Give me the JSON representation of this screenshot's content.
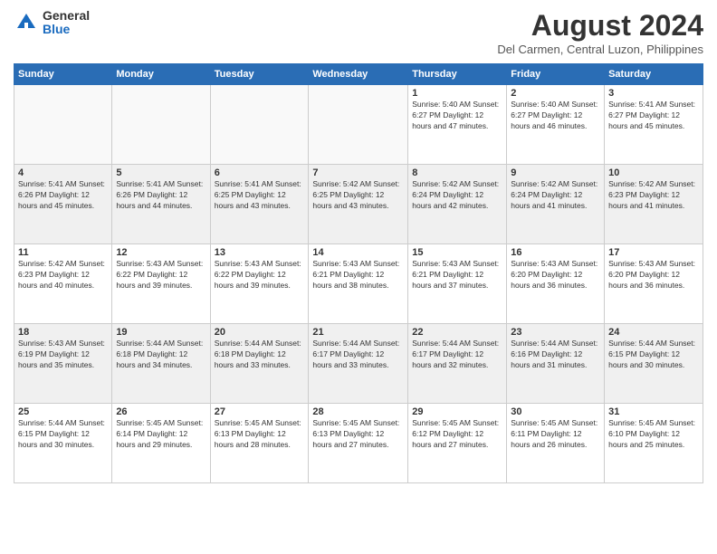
{
  "header": {
    "logo_general": "General",
    "logo_blue": "Blue",
    "month_year": "August 2024",
    "location": "Del Carmen, Central Luzon, Philippines"
  },
  "days_of_week": [
    "Sunday",
    "Monday",
    "Tuesday",
    "Wednesday",
    "Thursday",
    "Friday",
    "Saturday"
  ],
  "weeks": [
    [
      {
        "day": "",
        "info": ""
      },
      {
        "day": "",
        "info": ""
      },
      {
        "day": "",
        "info": ""
      },
      {
        "day": "",
        "info": ""
      },
      {
        "day": "1",
        "info": "Sunrise: 5:40 AM\nSunset: 6:27 PM\nDaylight: 12 hours\nand 47 minutes."
      },
      {
        "day": "2",
        "info": "Sunrise: 5:40 AM\nSunset: 6:27 PM\nDaylight: 12 hours\nand 46 minutes."
      },
      {
        "day": "3",
        "info": "Sunrise: 5:41 AM\nSunset: 6:27 PM\nDaylight: 12 hours\nand 45 minutes."
      }
    ],
    [
      {
        "day": "4",
        "info": "Sunrise: 5:41 AM\nSunset: 6:26 PM\nDaylight: 12 hours\nand 45 minutes."
      },
      {
        "day": "5",
        "info": "Sunrise: 5:41 AM\nSunset: 6:26 PM\nDaylight: 12 hours\nand 44 minutes."
      },
      {
        "day": "6",
        "info": "Sunrise: 5:41 AM\nSunset: 6:25 PM\nDaylight: 12 hours\nand 43 minutes."
      },
      {
        "day": "7",
        "info": "Sunrise: 5:42 AM\nSunset: 6:25 PM\nDaylight: 12 hours\nand 43 minutes."
      },
      {
        "day": "8",
        "info": "Sunrise: 5:42 AM\nSunset: 6:24 PM\nDaylight: 12 hours\nand 42 minutes."
      },
      {
        "day": "9",
        "info": "Sunrise: 5:42 AM\nSunset: 6:24 PM\nDaylight: 12 hours\nand 41 minutes."
      },
      {
        "day": "10",
        "info": "Sunrise: 5:42 AM\nSunset: 6:23 PM\nDaylight: 12 hours\nand 41 minutes."
      }
    ],
    [
      {
        "day": "11",
        "info": "Sunrise: 5:42 AM\nSunset: 6:23 PM\nDaylight: 12 hours\nand 40 minutes."
      },
      {
        "day": "12",
        "info": "Sunrise: 5:43 AM\nSunset: 6:22 PM\nDaylight: 12 hours\nand 39 minutes."
      },
      {
        "day": "13",
        "info": "Sunrise: 5:43 AM\nSunset: 6:22 PM\nDaylight: 12 hours\nand 39 minutes."
      },
      {
        "day": "14",
        "info": "Sunrise: 5:43 AM\nSunset: 6:21 PM\nDaylight: 12 hours\nand 38 minutes."
      },
      {
        "day": "15",
        "info": "Sunrise: 5:43 AM\nSunset: 6:21 PM\nDaylight: 12 hours\nand 37 minutes."
      },
      {
        "day": "16",
        "info": "Sunrise: 5:43 AM\nSunset: 6:20 PM\nDaylight: 12 hours\nand 36 minutes."
      },
      {
        "day": "17",
        "info": "Sunrise: 5:43 AM\nSunset: 6:20 PM\nDaylight: 12 hours\nand 36 minutes."
      }
    ],
    [
      {
        "day": "18",
        "info": "Sunrise: 5:43 AM\nSunset: 6:19 PM\nDaylight: 12 hours\nand 35 minutes."
      },
      {
        "day": "19",
        "info": "Sunrise: 5:44 AM\nSunset: 6:18 PM\nDaylight: 12 hours\nand 34 minutes."
      },
      {
        "day": "20",
        "info": "Sunrise: 5:44 AM\nSunset: 6:18 PM\nDaylight: 12 hours\nand 33 minutes."
      },
      {
        "day": "21",
        "info": "Sunrise: 5:44 AM\nSunset: 6:17 PM\nDaylight: 12 hours\nand 33 minutes."
      },
      {
        "day": "22",
        "info": "Sunrise: 5:44 AM\nSunset: 6:17 PM\nDaylight: 12 hours\nand 32 minutes."
      },
      {
        "day": "23",
        "info": "Sunrise: 5:44 AM\nSunset: 6:16 PM\nDaylight: 12 hours\nand 31 minutes."
      },
      {
        "day": "24",
        "info": "Sunrise: 5:44 AM\nSunset: 6:15 PM\nDaylight: 12 hours\nand 30 minutes."
      }
    ],
    [
      {
        "day": "25",
        "info": "Sunrise: 5:44 AM\nSunset: 6:15 PM\nDaylight: 12 hours\nand 30 minutes."
      },
      {
        "day": "26",
        "info": "Sunrise: 5:45 AM\nSunset: 6:14 PM\nDaylight: 12 hours\nand 29 minutes."
      },
      {
        "day": "27",
        "info": "Sunrise: 5:45 AM\nSunset: 6:13 PM\nDaylight: 12 hours\nand 28 minutes."
      },
      {
        "day": "28",
        "info": "Sunrise: 5:45 AM\nSunset: 6:13 PM\nDaylight: 12 hours\nand 27 minutes."
      },
      {
        "day": "29",
        "info": "Sunrise: 5:45 AM\nSunset: 6:12 PM\nDaylight: 12 hours\nand 27 minutes."
      },
      {
        "day": "30",
        "info": "Sunrise: 5:45 AM\nSunset: 6:11 PM\nDaylight: 12 hours\nand 26 minutes."
      },
      {
        "day": "31",
        "info": "Sunrise: 5:45 AM\nSunset: 6:10 PM\nDaylight: 12 hours\nand 25 minutes."
      }
    ]
  ]
}
